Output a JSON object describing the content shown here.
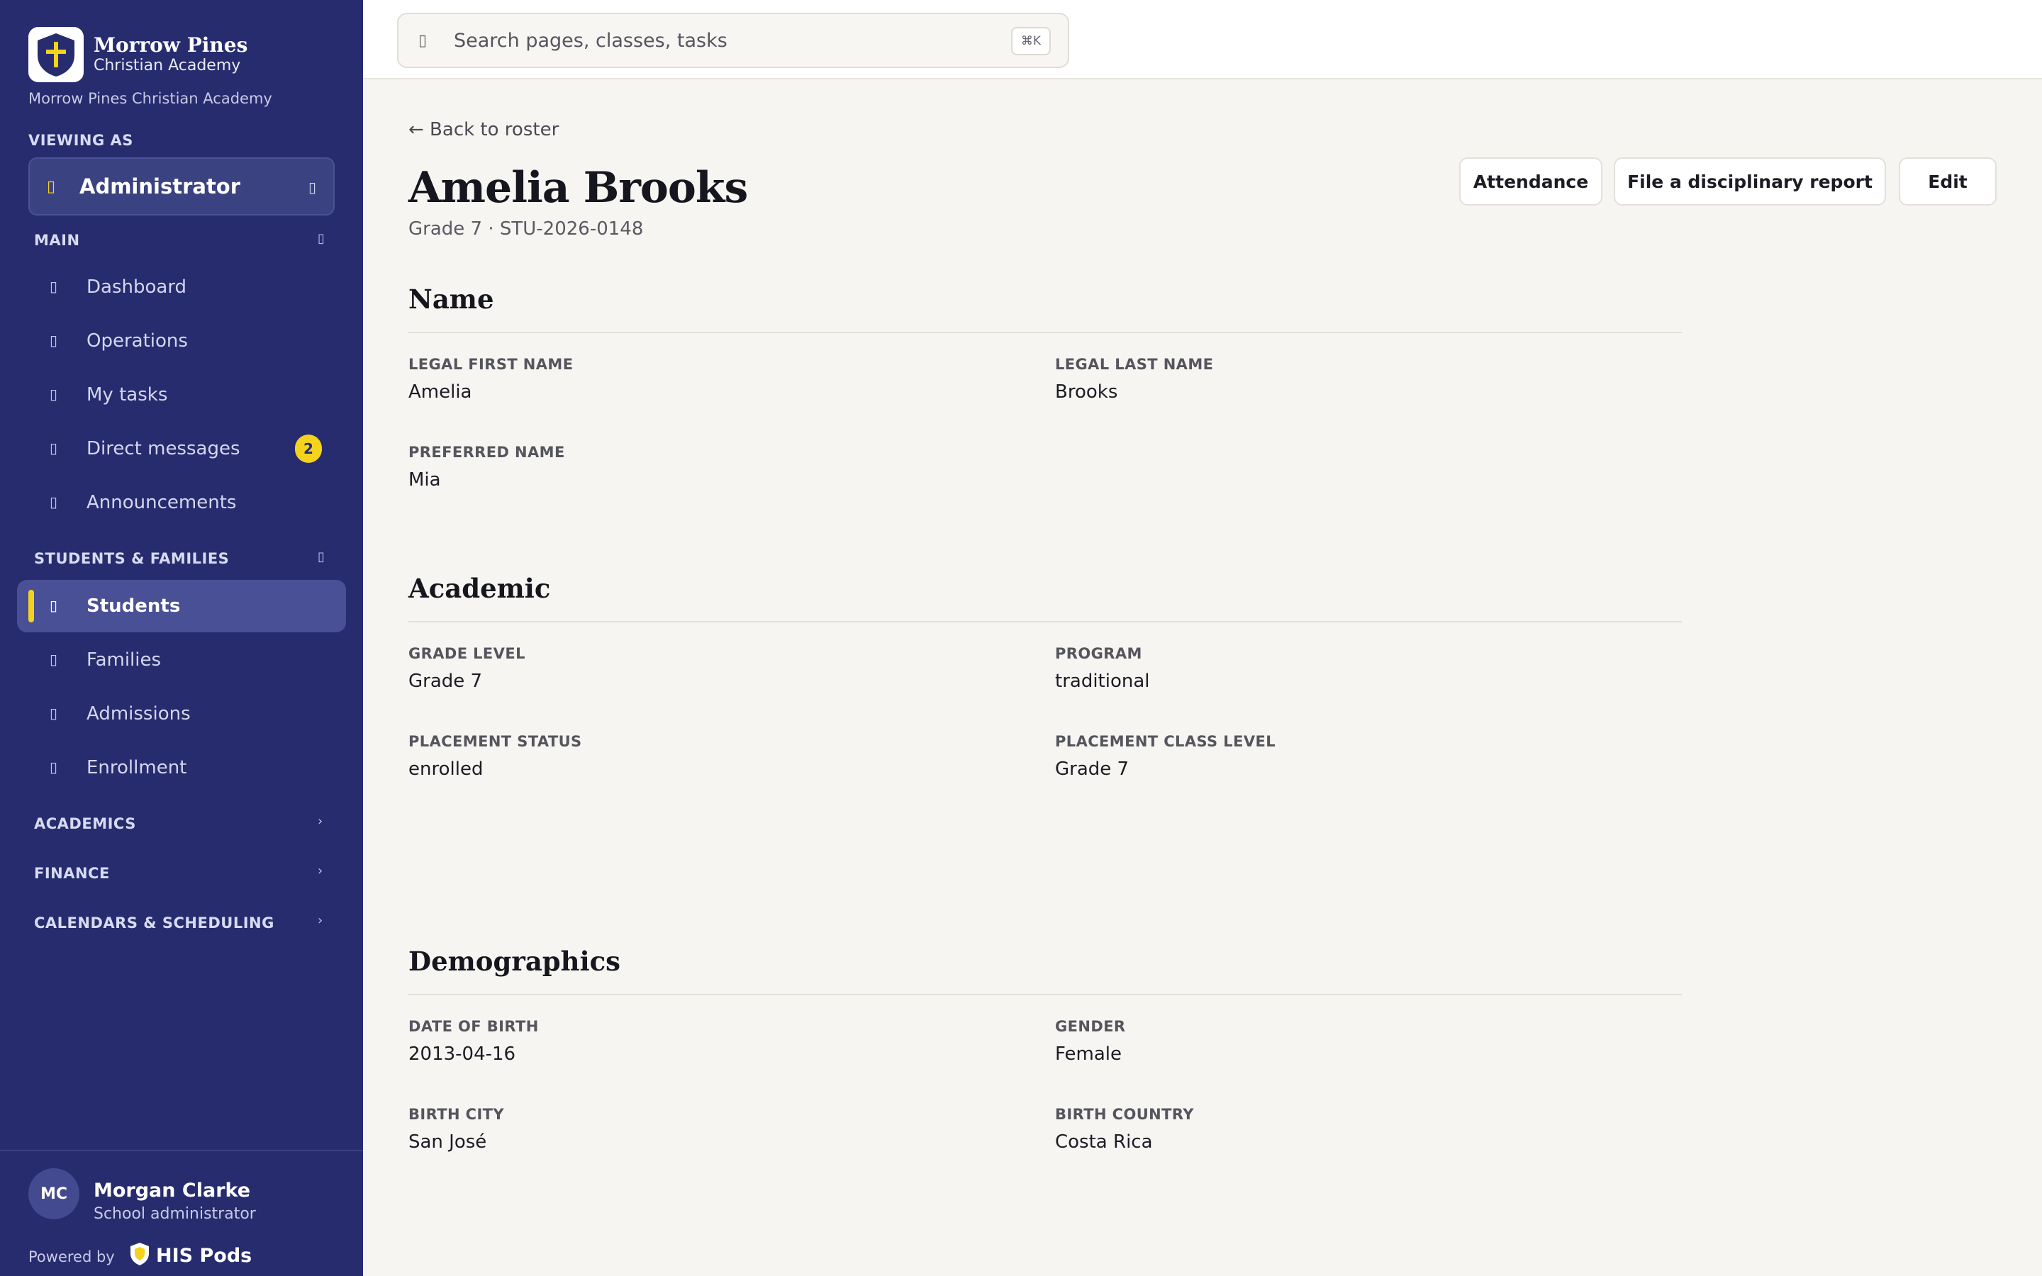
{
  "brand": {
    "name": "Morrow Pines",
    "subtitle": "Christian Academy",
    "caption": "Morrow Pines Christian Academy",
    "logo_icon": "shield-cross-icon"
  },
  "viewing_as": {
    "label": "Viewing as",
    "role": "Administrator"
  },
  "nav": {
    "main": {
      "label": "Main",
      "items": [
        {
          "label": "Dashboard",
          "icon": "home-icon"
        },
        {
          "label": "Operations",
          "icon": "grid-icon"
        },
        {
          "label": "My tasks",
          "icon": "checklist-icon"
        },
        {
          "label": "Direct messages",
          "icon": "message-icon",
          "badge": "2"
        },
        {
          "label": "Announcements",
          "icon": "megaphone-icon"
        }
      ]
    },
    "students_families": {
      "label": "Students & Families",
      "items": [
        {
          "label": "Students",
          "icon": "student-icon",
          "active": true
        },
        {
          "label": "Families",
          "icon": "family-icon"
        },
        {
          "label": "Admissions",
          "icon": "admissions-icon"
        },
        {
          "label": "Enrollment",
          "icon": "enrollment-icon"
        }
      ]
    },
    "collapsed": [
      {
        "label": "Academics"
      },
      {
        "label": "Finance"
      },
      {
        "label": "Calendars & Scheduling"
      }
    ]
  },
  "user": {
    "initials": "MC",
    "name": "Morgan Clarke",
    "role": "School administrator"
  },
  "footer": {
    "powered_by": "Powered by",
    "product": "HIS Pods"
  },
  "search": {
    "placeholder": "Search pages, classes, tasks",
    "shortcut": "⌘K"
  },
  "student": {
    "back_label": "← Back to roster",
    "name": "Amelia Brooks",
    "subtitle": "Grade 7 · STU-2026-0148"
  },
  "actions": {
    "attendance": "Attendance",
    "report": "File a disciplinary report",
    "edit": "Edit"
  },
  "sections": {
    "name": {
      "title": "Name",
      "fields": [
        {
          "label": "Legal first name",
          "value": "Amelia"
        },
        {
          "label": "Legal last name",
          "value": "Brooks"
        },
        {
          "label": "Preferred name",
          "value": "Mia"
        }
      ]
    },
    "academic": {
      "title": "Academic",
      "fields": [
        {
          "label": "Grade level",
          "value": "Grade 7"
        },
        {
          "label": "Program",
          "value": "traditional"
        },
        {
          "label": "Placement status",
          "value": "enrolled"
        },
        {
          "label": "Placement class level",
          "value": "Grade 7"
        }
      ]
    },
    "demographics": {
      "title": "Demographics",
      "fields": [
        {
          "label": "Date of birth",
          "value": "2013-04-16"
        },
        {
          "label": "Gender",
          "value": "Female"
        },
        {
          "label": "Birth city",
          "value": "San José"
        },
        {
          "label": "Birth country",
          "value": "Costa Rica"
        }
      ]
    }
  },
  "colors": {
    "sidebar": "#262c6e",
    "accent": "#f5d21c",
    "background": "#f7f5f2"
  }
}
